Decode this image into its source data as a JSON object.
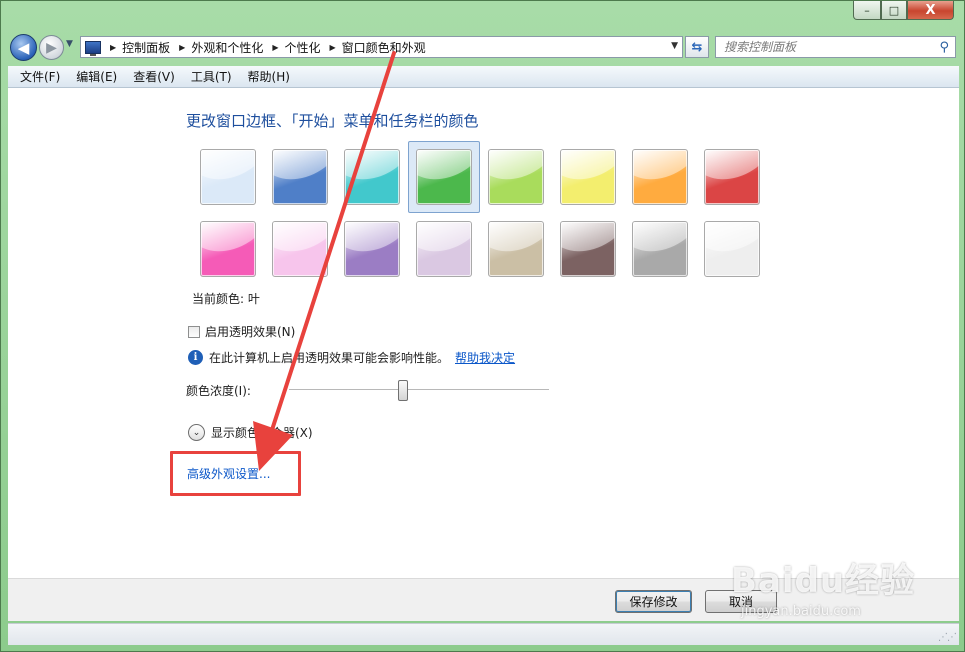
{
  "window": {
    "caption_buttons": {
      "minimize": "–",
      "maximize": "□",
      "close": "X"
    }
  },
  "nav": {
    "back_glyph": "◀",
    "forward_glyph": "▶",
    "breadcrumbs": [
      "控制面板",
      "外观和个性化",
      "个性化",
      "窗口颜色和外观"
    ],
    "search_placeholder": "搜索控制面板"
  },
  "menu": {
    "items": [
      "文件(F)",
      "编辑(E)",
      "查看(V)",
      "工具(T)",
      "帮助(H)"
    ]
  },
  "main": {
    "heading": "更改窗口边框、「开始」菜单和任务栏的颜色",
    "swatches": [
      {
        "name": "sky",
        "color": "#dbe9f8"
      },
      {
        "name": "twilight",
        "color": "#4f7fc8"
      },
      {
        "name": "sea",
        "color": "#42c8cc"
      },
      {
        "name": "leaf",
        "color": "#4cb84c",
        "selected": true
      },
      {
        "name": "lime",
        "color": "#a9dc5c"
      },
      {
        "name": "lemon",
        "color": "#f3ee6e"
      },
      {
        "name": "pumpkin",
        "color": "#ffab3f"
      },
      {
        "name": "ruby",
        "color": "#db4545"
      },
      {
        "name": "fuchsia",
        "color": "#f55bb7"
      },
      {
        "name": "blush",
        "color": "#f7c5ec"
      },
      {
        "name": "violet",
        "color": "#9b7dc4"
      },
      {
        "name": "lavender",
        "color": "#dac8e2"
      },
      {
        "name": "taupe",
        "color": "#cbbfa5"
      },
      {
        "name": "chocolate",
        "color": "#7c6262"
      },
      {
        "name": "slate",
        "color": "#a9a9a9"
      },
      {
        "name": "frost",
        "color": "#eeeeee"
      }
    ],
    "current_color_label": "当前颜色: 叶",
    "transparency_label": "启用透明效果(N)",
    "transparency_checked": false,
    "info_text": "在此计算机上启用透明效果可能会影响性能。",
    "help_link": "帮助我决定",
    "intensity_label": "颜色浓度(I):",
    "intensity_value": 0.44,
    "mixer_label": "显示颜色混合器(X)",
    "advanced_link": "高级外观设置..."
  },
  "footer": {
    "save_label": "保存修改",
    "cancel_label": "取消"
  },
  "watermark": {
    "logo": "Baidu经验",
    "url": "jingyan.baidu.com"
  },
  "colors": {
    "annotation": "#e8423d",
    "link": "#0b57c9",
    "heading": "#1e4f9e"
  }
}
